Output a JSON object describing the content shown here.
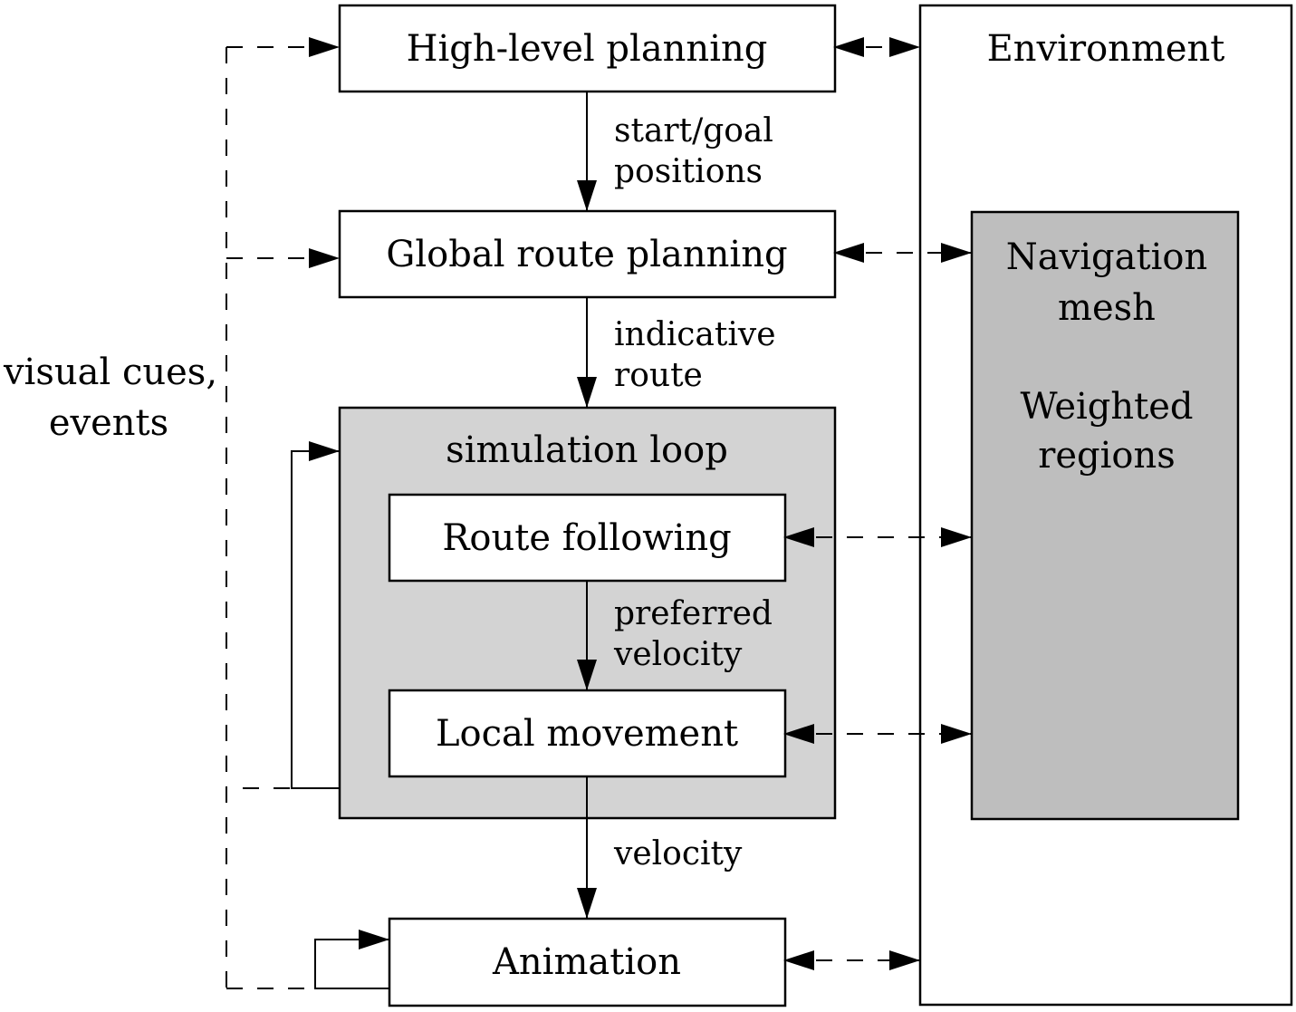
{
  "boxes": {
    "high_level": "High-level planning",
    "global_route": "Global route planning",
    "simulation_loop": "simulation loop",
    "route_following": "Route following",
    "local_movement": "Local movement",
    "animation": "Animation",
    "environment": "Environment",
    "navmesh_line1": "Navigation",
    "navmesh_line2": "mesh",
    "weighted_line1": "Weighted",
    "weighted_line2": "regions"
  },
  "edges": {
    "start_goal_1": "start/goal",
    "start_goal_2": "positions",
    "indicative_1": "indicative",
    "indicative_2": "route",
    "preferred_1": "preferred",
    "preferred_2": "velocity",
    "velocity": "velocity"
  },
  "side_label": {
    "line1": "visual cues,",
    "line2": "events"
  },
  "colors": {
    "loop_fill": "#d3d3d3",
    "navmesh_fill": "#bebebe"
  }
}
